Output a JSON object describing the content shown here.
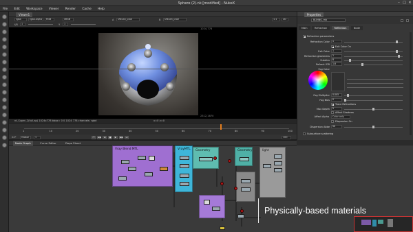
{
  "window": {
    "title": "Sphere (2).nk [modified] - NukeX"
  },
  "menu": [
    "File",
    "Edit",
    "Workspace",
    "Viewer",
    "Render",
    "Cache",
    "Help"
  ],
  "viewer": {
    "tab_label": "Viewer1",
    "channels_value": "rgba",
    "alpha_value": "rgba.alpha",
    "colorspace_value": "RGB",
    "proxy_value": "sRGB",
    "input_a": "1",
    "input_b": "2",
    "a_label": "A",
    "a_value": "Utkush_proe",
    "b_label": "B",
    "b_value": "Utkush_proe",
    "gain_label": "f/8",
    "gain_value": "1",
    "gamma_label": "Y",
    "gamma_value": "1",
    "zoom_value": "1:1",
    "mode_value": "2D",
    "status_left": "nt_Super_2(full-ap) 1024x778  bbox= 0 0 1024 778 channels: rgbd",
    "status_mid": "x=0 y=0",
    "coord_top": "1024,778",
    "coord_bottom": "2312,1870"
  },
  "timeline": {
    "fps_label": "24*",
    "range_mode": "Global",
    "current_frame": "1",
    "ticks": [
      "1",
      "10",
      "20",
      "30",
      "40",
      "50",
      "60",
      "70",
      "80",
      "90",
      "100"
    ],
    "end_frame": "100",
    "playhead": 0.74
  },
  "properties": {
    "tab_label": "Properties",
    "node_name": "BLINNG_mb",
    "subtabs": [
      "Main",
      "Refraction",
      "Reflection",
      "Node"
    ],
    "active_subtab": "Reflection",
    "section_header": "Refraction parameters",
    "rows": [
      {
        "label": "Refraction Color",
        "value": "1",
        "level": 0.92
      },
      {
        "label": "",
        "value": "",
        "level": null
      },
      {
        "label": "Exit Color",
        "value": "1",
        "level": 0.92
      },
      {
        "label": "Refraction glossiness",
        "value": "1",
        "level": 0.95
      },
      {
        "label": "Subdivs",
        "value": "8",
        "level": 0.08
      },
      {
        "label": "Refract IOR",
        "value": "1.6",
        "level": 0.3
      },
      {
        "label": "Fog Color",
        "value": "",
        "level": null
      }
    ],
    "exit_color_on_label": "Exit Color On",
    "affect_shadows_label": "Affect Shadows",
    "fog_rows": [
      {
        "label": "Fog Multiplier",
        "value": "0.005",
        "level": 0.05
      },
      {
        "label": "Fog Bias",
        "value": "0",
        "level": 0.0
      },
      {
        "label": "Max Depth",
        "value": "5",
        "level": 0.5
      },
      {
        "label": "Dispersion Abbe",
        "value": "50",
        "level": 0.5
      }
    ],
    "trace_refractions_label": "Trace Refractions",
    "affect_alpha_label": "Affect Alpha",
    "affect_alpha_value": "Color only",
    "dispersion_on_label": "Dispersion On",
    "subsurface_label": "Subsurface scattering"
  },
  "nodegraph": {
    "tabs": [
      "Node Graph",
      "Curve Editor",
      "Dope Sheet"
    ],
    "active_tab": "Node Graph",
    "backdrops": [
      {
        "label": "Vray Blend MTL",
        "color": "#9f6fd1"
      },
      {
        "label": "VrayMTL",
        "color": "#3fb6d9"
      },
      {
        "label": "Geometry",
        "color": "#5fbcb0"
      },
      {
        "label": "Geometry",
        "color": "#4fb0a6"
      },
      {
        "label": "light",
        "color": "#9a9a9a"
      },
      {
        "label": "",
        "color": "#8a8a8a"
      },
      {
        "label": "",
        "color": "#a57ad8"
      }
    ],
    "caption": "Physically-based materials"
  },
  "colors": {
    "backdrop_purple": "#9f6fd1",
    "backdrop_cyan": "#3fb6d9",
    "backdrop_teal": "#5fbcb0",
    "node_red": "#b01616",
    "playhead_orange": "#e8801e"
  }
}
